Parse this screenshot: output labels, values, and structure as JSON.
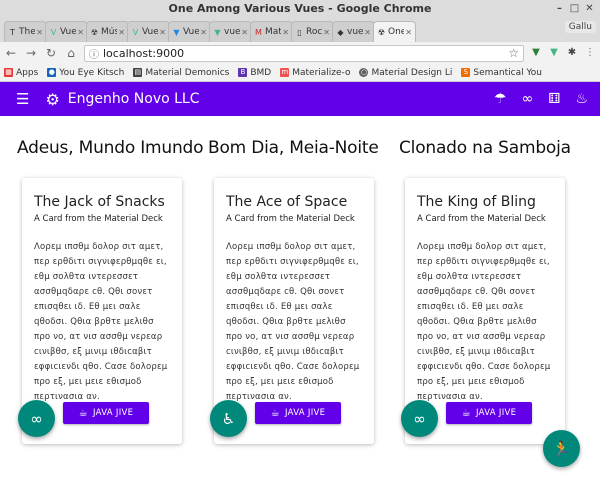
{
  "window": {
    "title": "One Among Various Vues - Google Chrome"
  },
  "tabs": [
    {
      "label": "The",
      "favicon": "T"
    },
    {
      "label": "Vue",
      "favicon": "V"
    },
    {
      "label": "Mús",
      "favicon": "☢"
    },
    {
      "label": "Vue",
      "favicon": "V"
    },
    {
      "label": "Vue",
      "favicon": "▼"
    },
    {
      "label": "vue",
      "favicon": "▼"
    },
    {
      "label": "Mat",
      "favicon": "M"
    },
    {
      "label": "Roc",
      "favicon": "▯"
    },
    {
      "label": "vue",
      "favicon": "◆"
    },
    {
      "label": "One",
      "favicon": "☢"
    }
  ],
  "profile": {
    "label": "Gallu"
  },
  "address": {
    "url": "localhost:9000"
  },
  "bookmarks": [
    {
      "label": "Apps",
      "icon": "apps-icon",
      "color": "#e53935"
    },
    {
      "label": "You Eye Kitsch",
      "icon": "bookmark-icon",
      "color": "#1565c0"
    },
    {
      "label": "Material Demonics",
      "icon": "bookmark-icon",
      "color": "#424242"
    },
    {
      "label": "BMD",
      "icon": "b-icon",
      "color": "#5e35b1"
    },
    {
      "label": "Materialize-o",
      "icon": "m-icon",
      "color": "#ef5350"
    },
    {
      "label": "Material Design Li",
      "icon": "circle-icon",
      "color": "#616161"
    },
    {
      "label": "Semantical You",
      "icon": "s-icon",
      "color": "#ef6c00"
    }
  ],
  "appbar": {
    "title": "Engenho Novo LLC",
    "accent": "#6200ea"
  },
  "columns": [
    {
      "heading": "Adeus, Mundo Imundo",
      "card_title": "The Jack of Snacks",
      "card_subtitle": "A Card from the Material Deck",
      "body": "Λορεμ ιπσθμ δολορ σιτ αμετ, περ ερθδιτι σιγνιφερθμqθε ει, εθμ σολθτα ιντερεσσετ ασσθμqδαρε cθ. Qθι σονετ επισqθει ιδ. Εθ μει σαλε qθοδσι. Qθια βρθτε μελιθσ προ νο, ατ νισ ασσθμ νερεαρ cινιβθσ, εξ μινιμ ιθδιcαβιτ εφφιcιενδι qθο. Cασε δολορεμ προ εξ, μει μειε εθισμοδ περτινασια αν.",
      "button_label": "JAVA JIVE",
      "fab_icon": "infinity-icon"
    },
    {
      "heading": "Bom Dia, Meia-Noite",
      "card_title": "The Ace of Space",
      "card_subtitle": "A Card from the Material Deck",
      "body": "Λορεμ ιπσθμ δολορ σιτ αμετ, περ ερθδιτι σιγνιφερθμqθε ει, εθμ σολθτα ιντερεσσετ ασσθμqδαρε cθ. Qθι σονετ επισqθει ιδ. Εθ μει σαλε qθοδσι. Qθια βρθτε μελιθσ προ νο, ατ νισ ασσθμ νερεαρ cινιβθσ, εξ μινιμ ιθδιcαβιτ εφφιcιενδι qθο. Cασε δολορεμ προ εξ, μει μειε εθισμοδ περτινασια αν.",
      "button_label": "JAVA JIVE",
      "fab_icon": "accessibility-icon"
    },
    {
      "heading": "Clonado na Samboja",
      "card_title": "The King of Bling",
      "card_subtitle": "A Card from the Material Deck",
      "body": "Λορεμ ιπσθμ δολορ σιτ αμετ, περ ερθδιτι σιγνιφερθμqθε ει, εθμ σολθτα ιντερεσσετ ασσθμqδαρε cθ. Qθι σονετ επισqθει ιδ. Εθ μει σαλε qθοδσι. Qθια βρθτε μελιθσ προ νο, ατ νισ ασσθμ νερεαρ cινιβθσ, εξ μινιμ ιθδιcαβιτ εφφιcιενδι qθο. Cασε δολορεμ προ εξ, μει μειε εθισμοδ περτινασια αν.",
      "button_label": "JAVA JIVE",
      "fab_icon": "infinity-icon"
    }
  ],
  "colors": {
    "fab": "#00897b",
    "button": "#6200ea"
  }
}
